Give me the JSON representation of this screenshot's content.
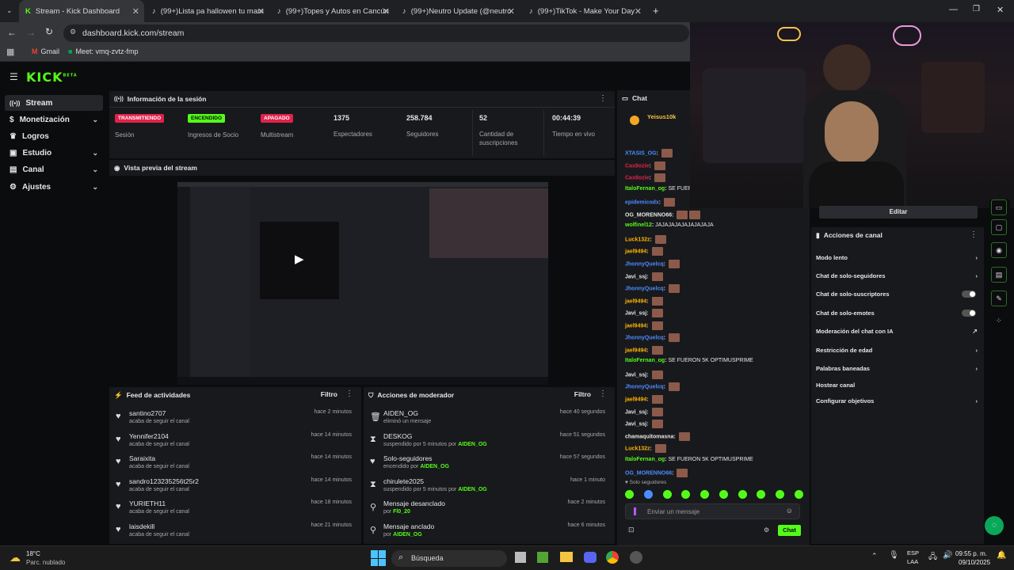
{
  "browser": {
    "tabs": [
      {
        "title": "Stream - Kick Dashboard",
        "active": true
      },
      {
        "title": "(99+)Lista pa hallowen tu mam"
      },
      {
        "title": "(99+)Topes y Autos en Cancún"
      },
      {
        "title": "(99+)Neutro Update (@neutro"
      },
      {
        "title": "(99+)TikTok - Make Your Day"
      }
    ],
    "url": "dashboard.kick.com/stream",
    "bookmarks": [
      "Gmail",
      "Meet: vmq-zvtz-fmp"
    ]
  },
  "app": {
    "logo": "KICK",
    "logo_sup": "BETA"
  },
  "sidebar": {
    "items": [
      {
        "label": "Stream",
        "icon": "broadcast-icon",
        "active": true,
        "chevron": false
      },
      {
        "label": "Monetización",
        "icon": "dollar-icon",
        "chevron": true
      },
      {
        "label": "Logros",
        "icon": "trophy-icon",
        "chevron": false
      },
      {
        "label": "Estudio",
        "icon": "studio-icon",
        "chevron": true
      },
      {
        "label": "Canal",
        "icon": "channel-icon",
        "chevron": true
      },
      {
        "label": "Ajustes",
        "icon": "gear-icon",
        "chevron": true
      }
    ]
  },
  "session": {
    "title": "Información de la sesión",
    "stats": [
      {
        "badge": "TRANSMITIENDO",
        "badge_color": "#e0224a",
        "label": "Sesión"
      },
      {
        "badge": "ENCENDIDO",
        "badge_color": "#53fc18",
        "label": "Ingresos de Socio"
      },
      {
        "badge": "APAGADO",
        "badge_color": "#e0224a",
        "label": "Multistream"
      },
      {
        "value": "1375",
        "label": "Espectadores"
      },
      {
        "value": "258.784",
        "label": "Seguidores"
      },
      {
        "value": "52",
        "label": "Cantidad de suscripciones"
      },
      {
        "value": "00:44:39",
        "label": "Tiempo en vivo"
      }
    ]
  },
  "preview": {
    "title": "Vista previa del stream"
  },
  "feed": {
    "title": "Feed de actividades",
    "filter": "Filtro",
    "items": [
      {
        "name": "santino2707",
        "sub": "acaba de seguir el canal",
        "time": "hace 2 minutos"
      },
      {
        "name": "Yennifer2104",
        "sub": "acaba de seguir el canal",
        "time": "hace 14 minutos"
      },
      {
        "name": "Saraixita",
        "sub": "acaba de seguir el canal",
        "time": "hace 14 minutos"
      },
      {
        "name": "sandro123235256t25r2",
        "sub": "acaba de seguir el canal",
        "time": "hace 14 minutos"
      },
      {
        "name": "YURIETH11",
        "sub": "acaba de seguir el canal",
        "time": "hace 18 minutos"
      },
      {
        "name": "laisdekill",
        "sub": "acaba de seguir el canal",
        "time": "hace 21 minutos"
      }
    ]
  },
  "mod": {
    "title": "Acciones de moderador",
    "filter": "Filtro",
    "items": [
      {
        "icon": "trash-icon",
        "name": "AIDEN_OG",
        "sub": "eliminó un mensaje",
        "by": "",
        "time": "hace 40 segundos"
      },
      {
        "icon": "hourglass-icon",
        "name": "DESKOG",
        "sub": "suspendido por 5 minutos por",
        "by": "AIDEN_OG",
        "time": "hace 51 segundos"
      },
      {
        "icon": "heart-icon",
        "name": "Solo-seguidores",
        "sub": "encendido por",
        "by": "AIDEN_OG",
        "time": "hace 57 segundos"
      },
      {
        "icon": "hourglass-icon",
        "name": "chirulete2025",
        "sub": "suspendido por 5 minutos por",
        "by": "AIDEN_OG",
        "time": "hace 1 minuto"
      },
      {
        "icon": "unpin-icon",
        "name": "Mensaje desanclado",
        "sub": "por",
        "by": "Fl0_20",
        "time": "hace 2 minutos"
      },
      {
        "icon": "pin-icon",
        "name": "Mensaje anclado",
        "sub": "por",
        "by": "AIDEN_OG",
        "time": "hace 6 minutos"
      }
    ]
  },
  "chat": {
    "title": "Chat",
    "pinned_user": "Yeisus10k",
    "messages": [
      {
        "user": "XTASIS_OG",
        "color": "#4b8cff",
        "text": "",
        "emotes": 1
      },
      {
        "user": "Cax8ozie",
        "color": "#e0224a",
        "text": "",
        "emotes": 1
      },
      {
        "user": "Cax8ozie",
        "color": "#e0224a",
        "text": "",
        "emotes": 1
      },
      {
        "user": "ItaloFernan_og",
        "color": "#53fc18",
        "text": "SE FUERON",
        "emotes": 0
      },
      {
        "user": "epidemicodx",
        "color": "#4b8cff",
        "text": "",
        "emotes": 1
      },
      {
        "user": "OG_MORENNO66",
        "color": "#e6e6e6",
        "text": "",
        "emotes": 2
      },
      {
        "user": "wolfinel12",
        "color": "#53fc18",
        "text": "JAJAJAJAJAJAJAJAJA",
        "emotes": 0
      },
      {
        "user": "Luck132z",
        "color": "#ffb400",
        "text": "",
        "emotes": 1
      },
      {
        "user": "jael9494",
        "color": "#ffb400",
        "text": "",
        "emotes": 1
      },
      {
        "user": "JhonnyQuelcq",
        "color": "#4b8cff",
        "text": "",
        "emotes": 1
      },
      {
        "user": "Javi_ssj",
        "color": "#e6e6e6",
        "text": "",
        "emotes": 1
      },
      {
        "user": "JhonnyQuelcq",
        "color": "#4b8cff",
        "text": "",
        "emotes": 1
      },
      {
        "user": "jael9494",
        "color": "#ffb400",
        "text": "",
        "emotes": 1
      },
      {
        "user": "Javi_ssj",
        "color": "#e6e6e6",
        "text": "",
        "emotes": 1
      },
      {
        "user": "jael9494",
        "color": "#ffb400",
        "text": "",
        "emotes": 1
      },
      {
        "user": "JhonnyQuelcq",
        "color": "#4b8cff",
        "text": "",
        "emotes": 1
      },
      {
        "user": "jael9494",
        "color": "#ffb400",
        "text": "",
        "emotes": 1
      },
      {
        "user": "ItaloFernan_og",
        "color": "#53fc18",
        "text": "SE FUERON 5K OPTIMUSPRIME",
        "emotes": 0
      },
      {
        "user": "Javi_ssj",
        "color": "#e6e6e6",
        "text": "",
        "emotes": 1
      },
      {
        "user": "JhonnyQuelcq",
        "color": "#4b8cff",
        "text": "",
        "emotes": 1
      },
      {
        "user": "jael9494",
        "color": "#ffb400",
        "text": "",
        "emotes": 1
      },
      {
        "user": "Javi_ssj",
        "color": "#e6e6e6",
        "text": "",
        "emotes": 1
      },
      {
        "user": "Javi_ssj",
        "color": "#e6e6e6",
        "text": "",
        "emotes": 1
      },
      {
        "user": "chamaquitomasna",
        "color": "#e6e6e6",
        "text": "",
        "emotes": 1
      },
      {
        "user": "Luck132z",
        "color": "#ffb400",
        "text": "",
        "emotes": 1
      },
      {
        "user": "ItaloFernan_og",
        "color": "#53fc18",
        "text": "SE FUERON 5K OPTIMUSPRIME",
        "emotes": 0
      },
      {
        "user": "OG_MORENNO66",
        "color": "#4b8cff",
        "text": "",
        "emotes": 1
      }
    ],
    "mode_notice": "Solo seguidores",
    "input_placeholder": "Enviar un mensaje",
    "send_label": "Chat"
  },
  "channel_actions": {
    "edit_label": "Editar",
    "title": "Acciones de canal",
    "items": [
      {
        "label": "Modo lento",
        "kind": "chevron"
      },
      {
        "label": "Chat de solo-seguidores",
        "kind": "chevron"
      },
      {
        "label": "Chat de solo-suscriptores",
        "kind": "toggle"
      },
      {
        "label": "Chat de solo-emotes",
        "kind": "toggle"
      },
      {
        "label": "Moderación del chat con IA",
        "kind": "external"
      },
      {
        "label": "Restricción de edad",
        "kind": "chevron"
      },
      {
        "label": "Palabras baneadas",
        "kind": "chevron"
      },
      {
        "label": "Hostear canal",
        "kind": "none"
      },
      {
        "label": "Configurar objetivos",
        "kind": "chevron"
      }
    ]
  },
  "taskbar": {
    "weather_temp": "18°C",
    "weather_desc": "Parc. nublado",
    "search_placeholder": "Búsqueda",
    "lang_top": "ESP",
    "lang_bottom": "LAA",
    "time": "09:55 p. m.",
    "date": "09/10/2025"
  }
}
